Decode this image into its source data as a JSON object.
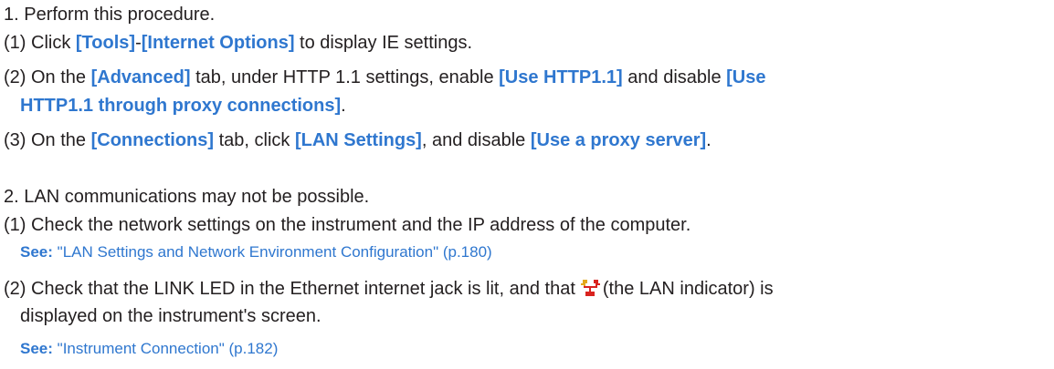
{
  "section1": {
    "heading": "1. Perform this procedure.",
    "step1": {
      "prefix": "(1) Click ",
      "tools": "[Tools]",
      "dash": "-",
      "internet_options": "[Internet Options]",
      "suffix": " to display IE settings."
    },
    "step2": {
      "prefix": "(2) On the ",
      "advanced": "[Advanced]",
      "mid1": " tab, under HTTP 1.1 settings, enable ",
      "use_http11": "[Use HTTP1.1]",
      "mid2": " and disable ",
      "use_http11_proxy_a": "[Use",
      "use_http11_proxy_b": "HTTP1.1 through proxy connections]",
      "end": "."
    },
    "step3": {
      "prefix": "(3) On the ",
      "connections": "[Connections]",
      "mid1": " tab, click ",
      "lan_settings": "[LAN Settings]",
      "mid2": ", and disable ",
      "use_proxy": "[Use a proxy server]",
      "end": "."
    }
  },
  "section2": {
    "heading": "2. LAN communications may not be possible.",
    "step1": {
      "text": "(1) Check the network settings on the instrument and the IP address of the computer.",
      "see_label": "See:",
      "see_link": "\"LAN Settings and Network Environment Configuration\" (p.180)"
    },
    "step2": {
      "text_a": "(2) Check that the LINK LED in the Ethernet internet jack is lit, and that",
      "text_b": "(the LAN indicator) is",
      "text_c": "displayed on the instrument's screen.",
      "see_label": "See:",
      "see_link": "\"Instrument Connection\" (p.182)"
    }
  },
  "icons": {
    "lan_indicator": "lan-indicator-icon"
  },
  "colors": {
    "text": "#231f20",
    "accent_blue": "#2f77cf",
    "lan_icon_red": "#d9231f",
    "lan_icon_gold": "#e3a81a"
  }
}
